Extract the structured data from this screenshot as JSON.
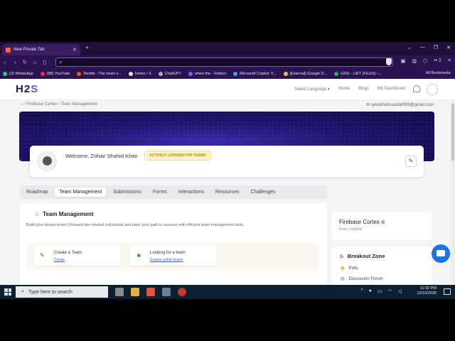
{
  "browser": {
    "tab_title": "New Private Tab",
    "bookmarks": [
      {
        "label": "(3) WhatsApp",
        "color": "#25d366"
      },
      {
        "label": "(88) YouTube",
        "color": "#ff2d2d"
      },
      {
        "label": "Reddit - The heart o...",
        "color": "#ff5700"
      },
      {
        "label": "Home / X",
        "color": "#dddddd"
      },
      {
        "label": "ChatGPT",
        "color": "#aaaaaa"
      },
      {
        "label": "when the - Roblox",
        "color": "#6666ff"
      },
      {
        "label": "Microsoft Copilot: Y...",
        "color": "#3aa0ff"
      },
      {
        "label": "[External] Google D...",
        "color": "#f5c242"
      },
      {
        "label": "GDG - LIET (FILES) -...",
        "color": "#34a853"
      }
    ],
    "all_bookmarks": "All Bookmarks",
    "badge_count": "2"
  },
  "site": {
    "logo_main": "H2",
    "logo_accent": "S",
    "language": "Select Language",
    "nav": [
      "Home",
      "Blogs",
      "My Dashboard"
    ]
  },
  "breadcrumb": "⌂ / Firebase Cortex / Team Management",
  "email": "syedahafssasdaf009@gmail.com",
  "welcome": {
    "text": "Welcome, Zohair Shahid Khan",
    "badge": "ACTIVELY LOOKING FOR TEAMS"
  },
  "tabs": [
    "Roadmap",
    "Team Management",
    "Submissions",
    "Forms",
    "Interactions",
    "Resources",
    "Challenges"
  ],
  "team_card": {
    "title": "Team Management",
    "description": "Build your dream team! Onboard like-minded individuals and pave your path to success with efficient team management tools.",
    "actions": [
      {
        "title": "Create a Team",
        "link": "Create"
      },
      {
        "title": "Looking for a team",
        "link": "Explore public teams"
      }
    ]
  },
  "event": {
    "title": "Firebase Cortex",
    "subtitle": "Free | Hybrid"
  },
  "breakout": {
    "title": "Breakout Zone",
    "items": [
      "Polls",
      "Discussion Forum"
    ]
  },
  "taskbar": {
    "search_placeholder": "Type here to search",
    "time": "11:32 PM",
    "date": "12/10/2025"
  }
}
